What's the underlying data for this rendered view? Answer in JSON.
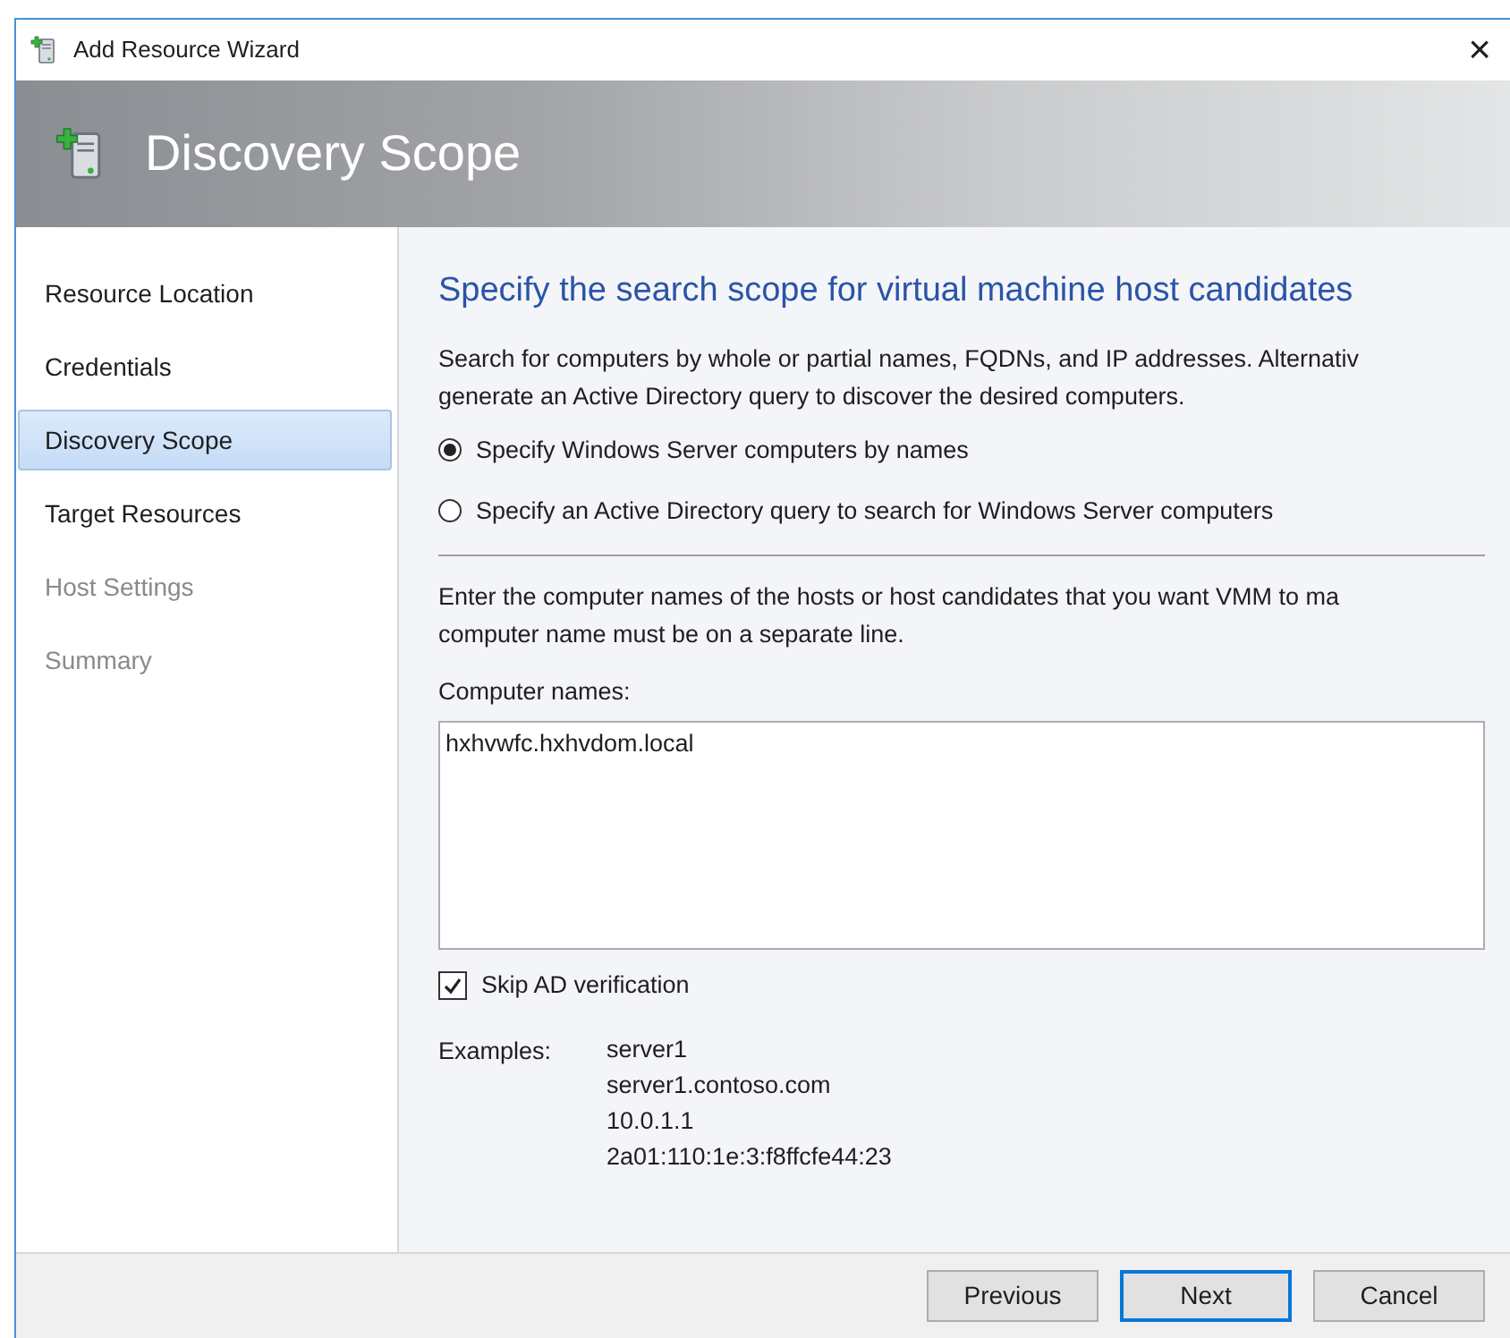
{
  "window": {
    "title": "Add Resource Wizard",
    "close": "×"
  },
  "header": {
    "title": "Discovery Scope"
  },
  "steps": [
    {
      "label": "Resource Location",
      "selected": false,
      "disabled": false
    },
    {
      "label": "Credentials",
      "selected": false,
      "disabled": false
    },
    {
      "label": "Discovery Scope",
      "selected": true,
      "disabled": false
    },
    {
      "label": "Target Resources",
      "selected": false,
      "disabled": false
    },
    {
      "label": "Host Settings",
      "selected": false,
      "disabled": true
    },
    {
      "label": "Summary",
      "selected": false,
      "disabled": true
    }
  ],
  "content": {
    "heading": "Specify the search scope for virtual machine host candidates",
    "description": "Search for computers by whole or partial names, FQDNs, and IP addresses. Alternativ\ngenerate an Active Directory query to discover the desired computers.",
    "options": [
      {
        "label": "Specify Windows Server computers by names",
        "selected": true
      },
      {
        "label": "Specify an Active Directory query to search for Windows Server computers",
        "selected": false
      }
    ],
    "instructions": "Enter the computer names of the hosts or host candidates that you want VMM to ma\ncomputer name must be on a separate line.",
    "names_label": "Computer names:",
    "names_value": "hxhvwfc.hxhvdom.local",
    "skip_ad": {
      "label": "Skip AD verification",
      "checked": true
    },
    "examples_label": "Examples:",
    "examples": [
      "server1",
      "server1.contoso.com",
      "10.0.1.1",
      "2a01:110:1e:3:f8ffcfe44:23"
    ]
  },
  "buttons": [
    {
      "label": "Previous",
      "default": false
    },
    {
      "label": "Next",
      "default": true
    },
    {
      "label": "Cancel",
      "default": false
    }
  ]
}
